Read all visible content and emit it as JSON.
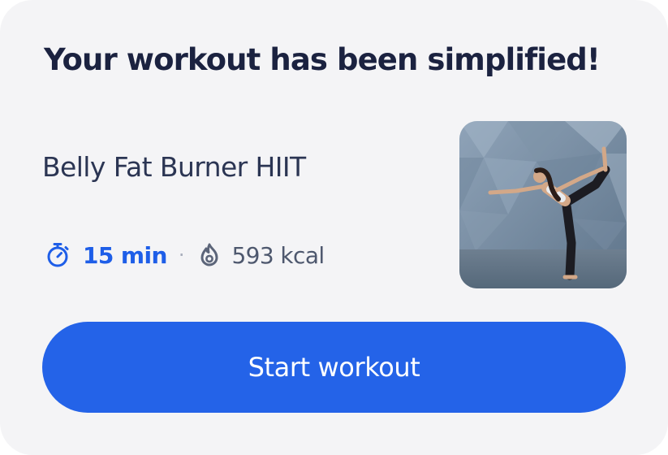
{
  "card": {
    "title": "Your workout has been simplified!",
    "workout_name": "Belly Fat Burner HIIT",
    "duration": {
      "icon": "stopwatch-icon",
      "value": "15 min"
    },
    "separator": "·",
    "calories": {
      "icon": "flame-icon",
      "value": "593 kcal"
    },
    "thumbnail": {
      "alt": "Woman in a standing bow yoga pose"
    },
    "start_button_label": "Start workout"
  },
  "colors": {
    "card_background": "#f4f4f6",
    "title": "#1b2240",
    "accent": "#2463e8",
    "duration_text": "#1e5ee8",
    "muted_text": "#4e586e",
    "button_text": "#ffffff"
  }
}
